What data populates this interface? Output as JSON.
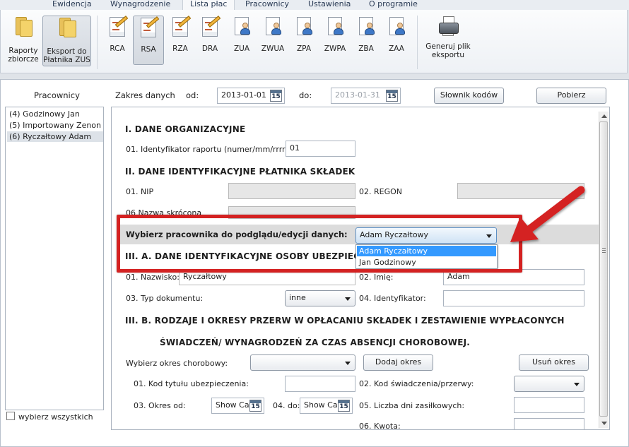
{
  "menu": {
    "items": [
      "Ewidencja",
      "Wynagrodzenie",
      "Lista płac",
      "Pracownicy",
      "Ustawienia",
      "O programie"
    ],
    "active_index": 2
  },
  "ribbon": {
    "raporty_zbiorcze": [
      "Raporty",
      "zbiorcze"
    ],
    "eksport": [
      "Eksport do",
      "Płatnika ZUS"
    ],
    "docs": [
      "RCA",
      "RSA",
      "RZA",
      "DRA"
    ],
    "pressed": "RSA",
    "person_docs": [
      "ZUA",
      "ZWUA",
      "ZPA",
      "ZWPA",
      "ZBA",
      "ZAA"
    ],
    "generate": [
      "Generuj plik",
      "eksportu"
    ],
    "icons": {
      "folder": "folder-icon",
      "document": "document-edit-icon",
      "person": "person-document-icon",
      "printer": "printer-icon"
    }
  },
  "left": {
    "title": "Pracownicy",
    "employees": [
      "(4) Godzinowy Jan",
      "(5) Importowany Zenon",
      "(6) Ryczałtowy Adam"
    ],
    "selected_index": 2,
    "select_all": "wybierz wszystkich"
  },
  "toolbar": {
    "range_label": "Zakres danych",
    "from_label": "od:",
    "from_value": "2013-01-01",
    "to_label": "do:",
    "to_value": "2013-01-31",
    "calendar_day": "15",
    "dictionary_button": "Słownik kodów",
    "fetch_button": "Pobierz"
  },
  "form": {
    "section1": "I. DANE ORGANIZACYJNE",
    "report_id_label": "01. Identyfikator raportu (numer/mm/rrrr)",
    "report_id_value": "01",
    "section2": "II. DANE IDENTYFIKACYJNE PŁATNIKA SKŁADEK",
    "nip_label": "01. NIP",
    "regon_label": "02. REGON",
    "short_name_label": "06 Nazwa skrócona",
    "employee_picker_label": "Wybierz pracownika do podglądu/edycji danych:",
    "employee_picker_value": "Adam Ryczałtowy",
    "employee_options": [
      "Adam Ryczałtowy",
      "Jan Godzinowy"
    ],
    "section3a": "III. A. DANE IDENTYFIKACYJNE OSOBY UBEZPIECZONEJ",
    "surname_label": "01. Nazwisko:",
    "surname_value": "Ryczałtowy",
    "firstname_label": "02. Imię:",
    "firstname_value": "Adam",
    "doc_type_label": "03. Typ dokumentu:",
    "doc_type_value": "inne",
    "identifier_label": "04. Identyfikator:",
    "section3b_line1": "III. B. RODZAJE I OKRESY PRZERW W OPŁACANIU SKŁADEK I ZESTAWIENIE WYPŁACONYCH",
    "section3b_line2": "ŚWIADCZEŃ/ WYNAGRODZEŃ ZA CZAS ABSENCJI CHOROBOWEJ.",
    "sick_period_label": "Wybierz okres chorobowy:",
    "add_period_button": "Dodaj okres",
    "remove_period_button": "Usuń okres",
    "insurance_code_label": "01. Kod tytułu ubezpieczenia:",
    "benefit_code_label": "02. Kod świadczenia/przerwy:",
    "period_from_label": "03. Okres od:",
    "period_to_label": "04. do:",
    "show_calendar": "Show Ca",
    "days_label": "05. Liczba dni zasiłkowych:",
    "amount_label": "06. Kwota:"
  },
  "colors": {
    "annotation": "#d42222",
    "selection": "#3399ff"
  }
}
